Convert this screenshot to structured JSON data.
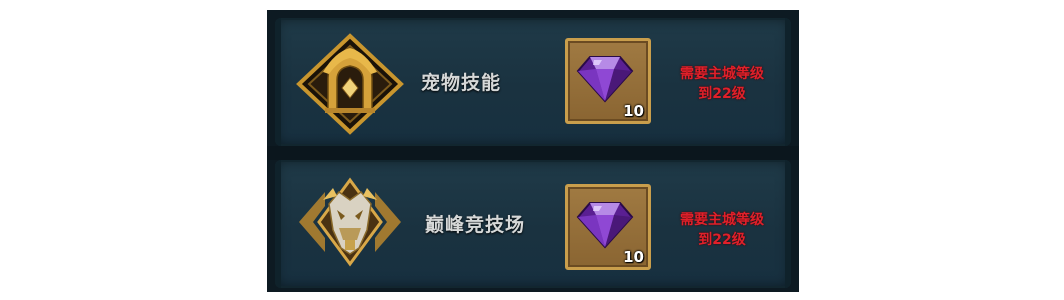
{
  "rows": [
    {
      "title": "宠物技能",
      "emblem": "pet-skill-emblem",
      "item_icon": "purple-gem-icon",
      "item_count": "10",
      "requirement_line1": "需要主城等级",
      "requirement_line2": "到22级"
    },
    {
      "title": "巅峰竞技场",
      "emblem": "peak-arena-emblem",
      "item_icon": "purple-gem-icon",
      "item_count": "10",
      "requirement_line1": "需要主城等级",
      "requirement_line2": "到22级"
    }
  ],
  "colors": {
    "requirement": "#e0202a",
    "title": "#d6d8d8",
    "gold": "#c99e4c",
    "gem": "#7a2fb8"
  }
}
